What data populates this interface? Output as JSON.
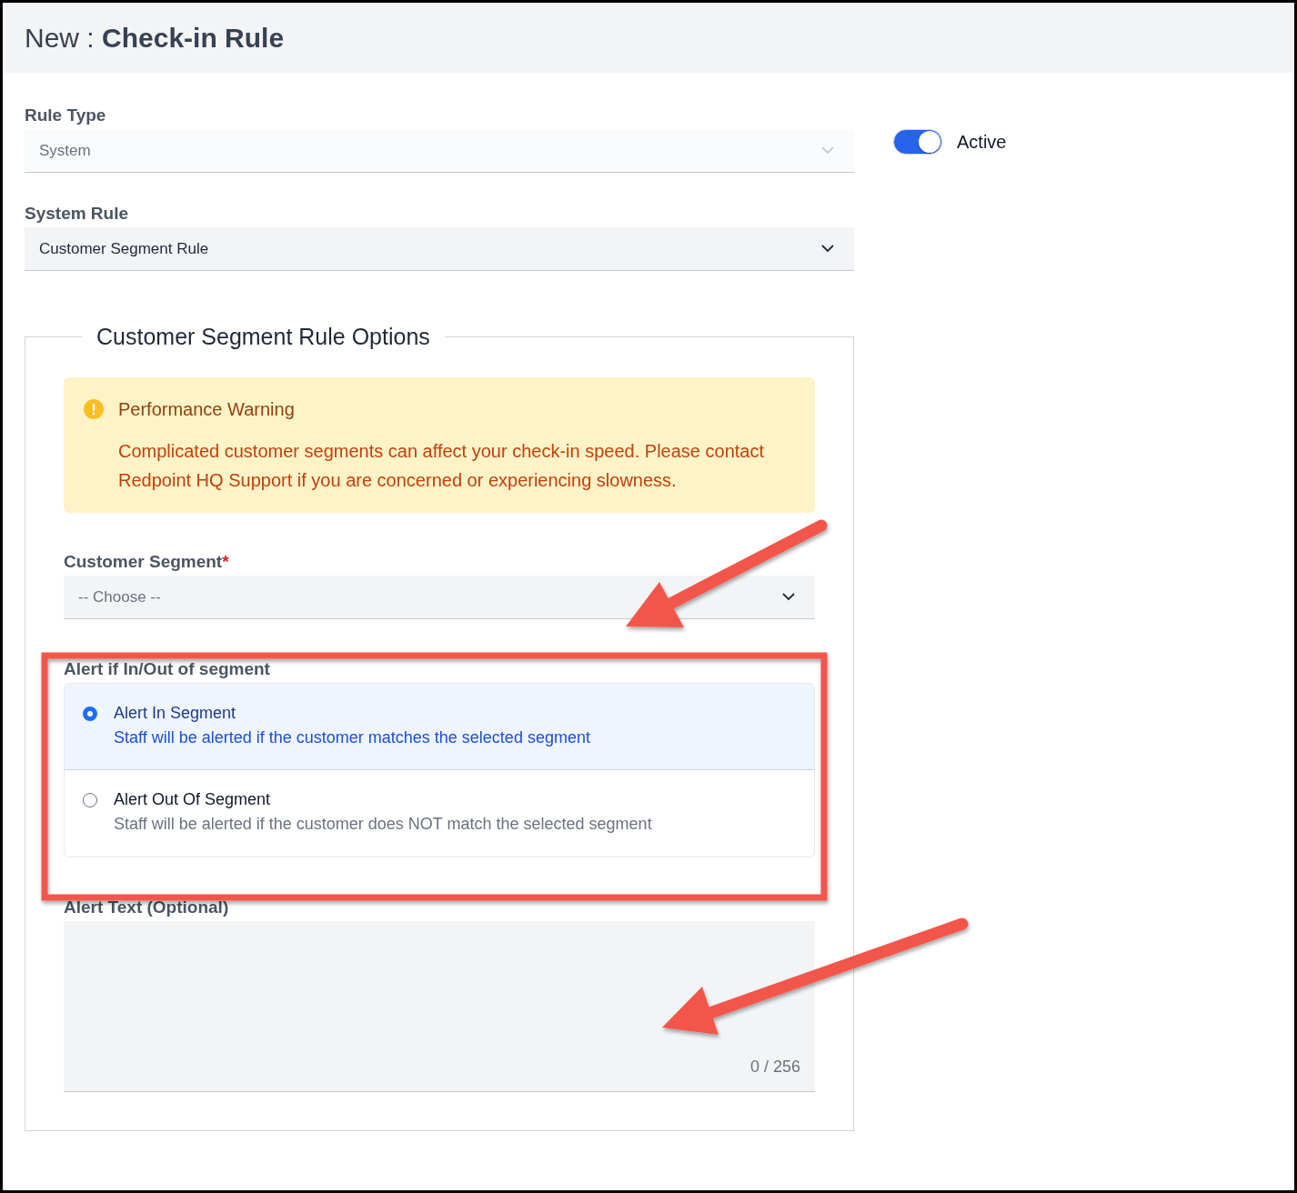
{
  "header": {
    "prefix": "New :",
    "title": "Check-in Rule"
  },
  "fields": [
    {
      "label": "Rule Type",
      "value": "System",
      "disabled": true
    },
    {
      "label": "System Rule",
      "value": "Customer Segment Rule",
      "disabled": false
    }
  ],
  "active_toggle": {
    "label": "Active",
    "on": true
  },
  "options_panel": {
    "legend": "Customer Segment Rule Options",
    "warning": {
      "title": "Performance Warning",
      "message": "Complicated customer segments can affect your check-in speed. Please contact Redpoint HQ Support if you are concerned or experiencing slowness."
    },
    "segment_select": {
      "label": "Customer Segment",
      "required_mark": "*",
      "placeholder": "-- Choose --"
    },
    "alert_mode": {
      "label": "Alert if In/Out of segment",
      "options": [
        {
          "title": "Alert In Segment",
          "description": "Staff will be alerted if the customer matches the selected segment",
          "selected": true
        },
        {
          "title": "Alert Out Of Segment",
          "description": "Staff will be alerted if the customer does NOT match the selected segment",
          "selected": false
        }
      ]
    },
    "alert_text": {
      "label": "Alert Text (Optional)",
      "counter": "0 / 256"
    }
  }
}
